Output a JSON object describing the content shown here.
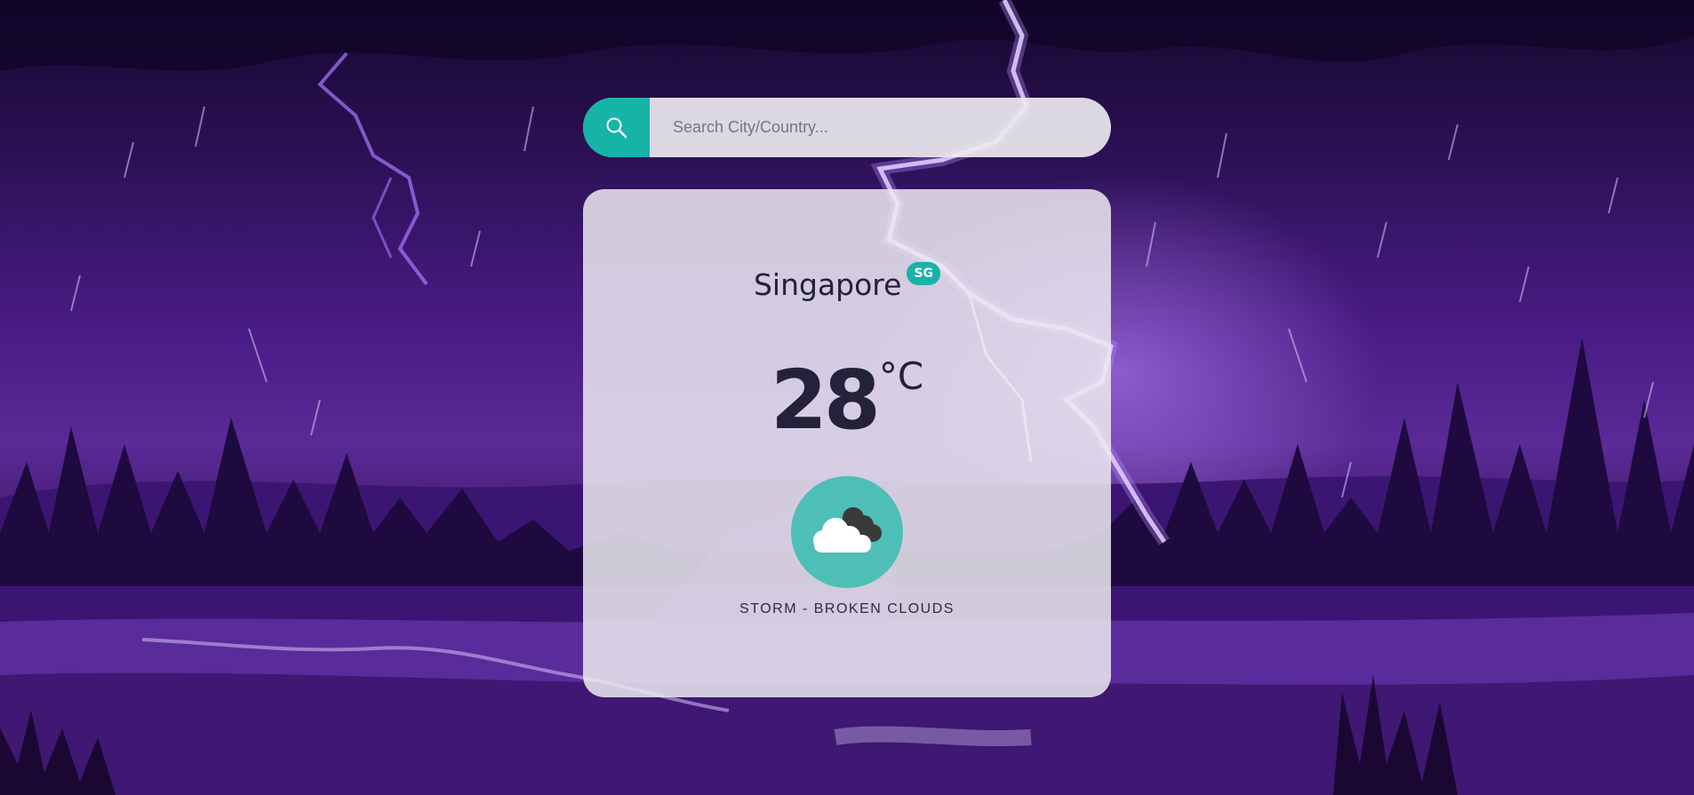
{
  "search": {
    "placeholder": "Search City/Country...",
    "value": ""
  },
  "weather": {
    "city": "Singapore",
    "country_code": "SG",
    "temperature": "28",
    "unit": "°C",
    "description": "STORM - BROKEN CLOUDS",
    "icon": "broken-clouds-icon"
  },
  "colors": {
    "accent": "#18b3a7",
    "icon_circle": "#4dbfb6",
    "text": "#24213a"
  }
}
